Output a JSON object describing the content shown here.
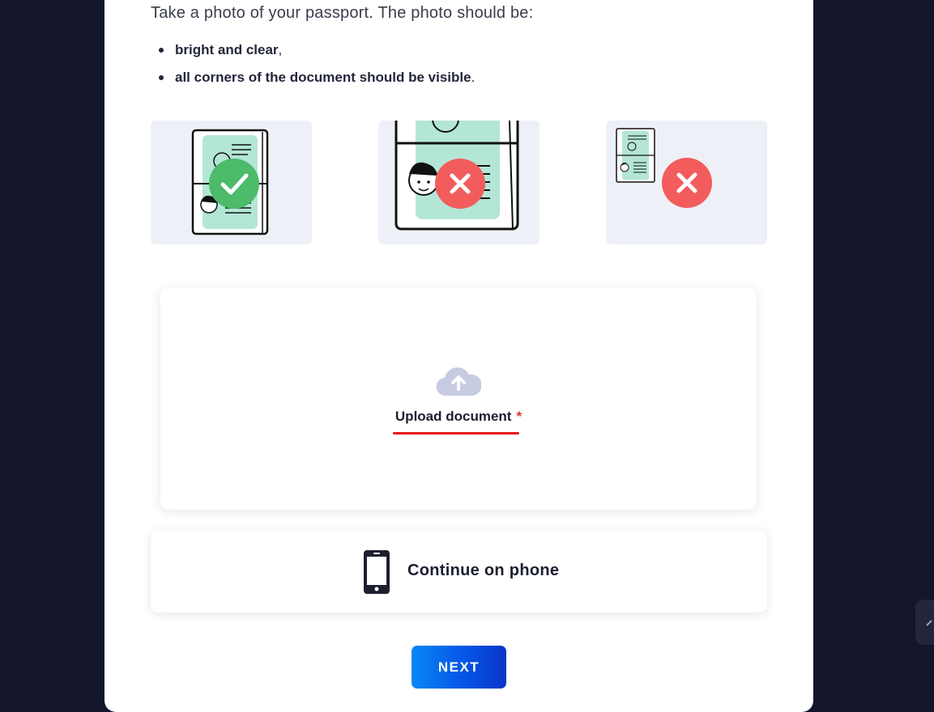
{
  "instructions": {
    "intro": "Take a photo of your passport. The photo should be:",
    "bullets": [
      {
        "bold": "bright and clear",
        "suffix": ","
      },
      {
        "bold": "all corners of the document should be visible",
        "suffix": "."
      }
    ]
  },
  "examples": [
    {
      "status": "good",
      "icon": "check-icon",
      "color": "#4cbb6a"
    },
    {
      "status": "bad-too-close",
      "icon": "cross-icon",
      "color": "#f25c5c"
    },
    {
      "status": "bad-too-far",
      "icon": "cross-icon",
      "color": "#f25c5c"
    }
  ],
  "upload": {
    "label": "Upload document",
    "required_mark": "*",
    "icon": "cloud-upload-icon"
  },
  "continue_on_phone": {
    "label": "Continue on phone",
    "icon": "smartphone-icon"
  },
  "next_button": {
    "label": "NEXT"
  },
  "colors": {
    "background": "#13152b",
    "accent": "#0556e6",
    "success": "#4cbb6a",
    "error": "#f25c5c",
    "required": "#e5302a"
  }
}
